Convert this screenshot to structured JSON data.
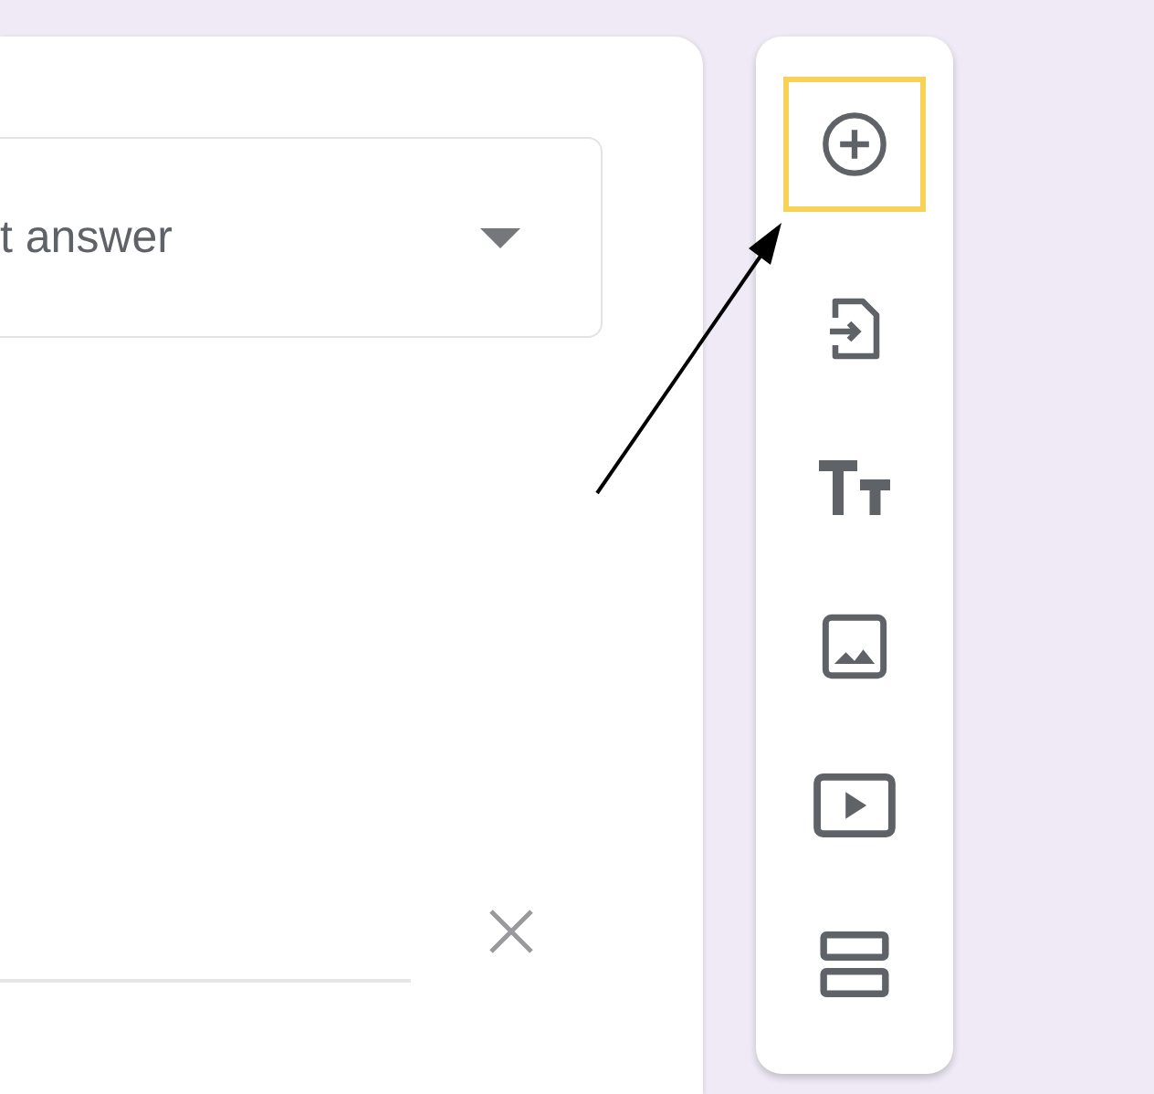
{
  "question_card": {
    "answer_type_dropdown": {
      "value": "t answer"
    }
  },
  "toolbar": {
    "items": [
      {
        "kind": "add",
        "highlighted": true
      },
      {
        "kind": "import",
        "highlighted": false
      },
      {
        "kind": "title",
        "highlighted": false
      },
      {
        "kind": "image",
        "highlighted": false
      },
      {
        "kind": "video",
        "highlighted": false
      },
      {
        "kind": "section",
        "highlighted": false
      }
    ]
  }
}
